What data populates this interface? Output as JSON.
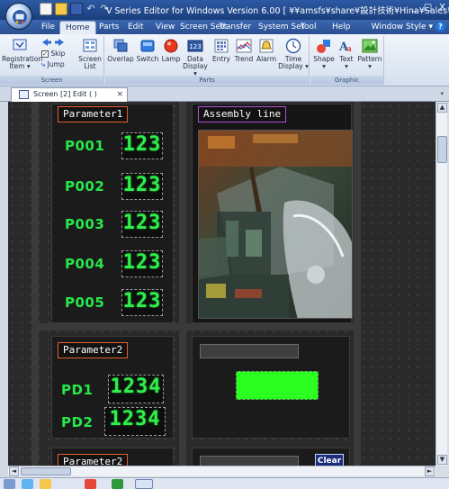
{
  "window": {
    "title": "V Series Editor for Windows Version 6.00 [ ¥¥amsfs¥share¥設計技術¥Hina¥Sales¥DEMO¥Japanese¥長...",
    "minimize_label": "_",
    "maximize_label": "□",
    "close_label": "X"
  },
  "menu": {
    "tabs": [
      "File",
      "Home",
      "Parts",
      "Edit",
      "View",
      "Screen Sett",
      "Transfer",
      "System Set",
      "Tool",
      "Help"
    ],
    "active_tab": "Home",
    "window_style": "Window Style",
    "window_style_arrow": "▾",
    "help_icon_label": "?"
  },
  "ribbon": {
    "screen_group": {
      "label": "Screen",
      "registration_item": "Registration\nItem ▾",
      "skip": "Skip",
      "jump": "Jump",
      "screen_list": "Screen\nList"
    },
    "parts_group": {
      "label": "Parts",
      "items": [
        "Overlap",
        "Switch",
        "Lamp",
        "Data\nDisplay ▾",
        "Entry",
        "Trend",
        "Alarm",
        "Time\nDisplay ▾"
      ]
    },
    "graphic_group": {
      "label": "Graphic",
      "items": [
        "Shape\n▾",
        "Text\n▾",
        "Pattern\n▾"
      ]
    }
  },
  "doc_tab": {
    "label": "Screen [2] Edit (        )",
    "close": "×",
    "strip_arrow": "▾"
  },
  "scrollbars": {
    "up_arrow": "▲",
    "down_arrow": "▼",
    "left_arrow": "◄",
    "right_arrow": "►"
  },
  "screen": {
    "panel1": {
      "title": "Parameter1",
      "rows": [
        {
          "label": "P001",
          "value": "123"
        },
        {
          "label": "P002",
          "value": "123"
        },
        {
          "label": "P003",
          "value": "123"
        },
        {
          "label": "P004",
          "value": "123"
        },
        {
          "label": "P005",
          "value": "123"
        }
      ]
    },
    "assembly": {
      "title": "Assembly line"
    },
    "panel2": {
      "title": "Parameter2",
      "rows": [
        {
          "label": "PD1",
          "value": "1234"
        },
        {
          "label": "PD2",
          "value": "1234"
        }
      ]
    },
    "panel3": {
      "title": "Parameter2"
    },
    "clear_button": "Clear"
  },
  "colors": {
    "segment_green": "#2ff04a",
    "label_green": "#27e64a",
    "title_border_orange": "#e0612a",
    "title_border_purple": "#b04fd1",
    "lamp_green": "#2bff22"
  }
}
